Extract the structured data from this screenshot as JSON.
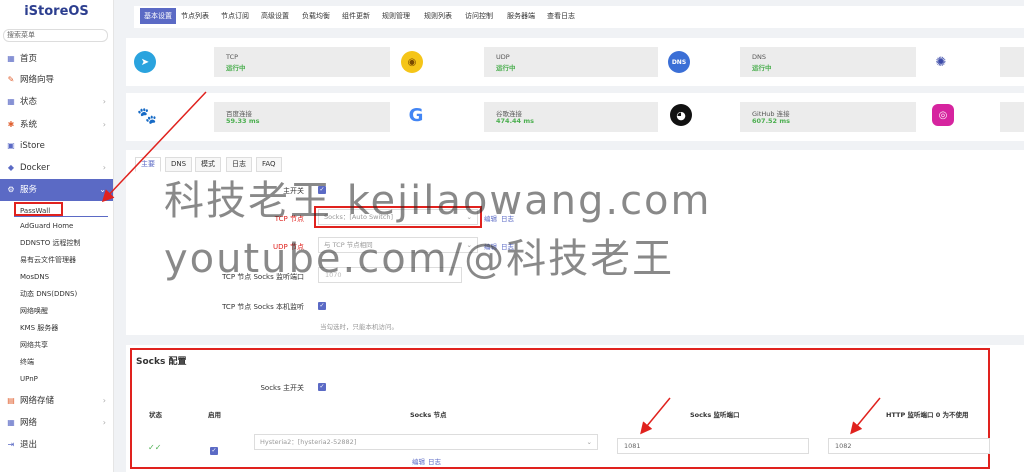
{
  "sidebar": {
    "logo": "iStoreOS",
    "search": "搜索菜单",
    "items": [
      {
        "label": "首页",
        "icon": "home-icon"
      },
      {
        "label": "网络向导",
        "icon": "wizard-icon"
      },
      {
        "label": "状态",
        "icon": "status-icon"
      },
      {
        "label": "系统",
        "icon": "gear-icon"
      },
      {
        "label": "iStore",
        "icon": "store-icon"
      },
      {
        "label": "Docker",
        "icon": "docker-icon"
      },
      {
        "label": "服务",
        "icon": "service-icon"
      },
      {
        "label": "网络存储",
        "icon": "storage-icon"
      },
      {
        "label": "网络",
        "icon": "network-icon"
      },
      {
        "label": "退出",
        "icon": "logout-icon"
      }
    ],
    "subitems": [
      "PassWall",
      "AdGuard Home",
      "DDNSTO 远程控制",
      "易有云文件管理器",
      "MosDNS",
      "动态 DNS(DDNS)",
      "网络唤醒",
      "KMS 服务器",
      "网络共享",
      "终端",
      "UPnP"
    ]
  },
  "topbar": {
    "tabs": [
      "基本设置",
      "节点列表",
      "节点订阅",
      "高级设置",
      "负载均衡",
      "组件更新",
      "规则管理",
      "规则列表",
      "访问控制",
      "服务器端",
      "查看日志"
    ]
  },
  "status_tiles": [
    {
      "title": "TCP",
      "status": "运行中",
      "icon": "telegram-icon"
    },
    {
      "title": "UDP",
      "status": "运行中",
      "icon": "gamepad-icon"
    },
    {
      "title": "DNS",
      "status": "运行中",
      "icon": "dns-icon"
    },
    {
      "title": "百度连接",
      "status": "59.33 ms",
      "icon": "baidu-icon"
    },
    {
      "title": "谷歌连接",
      "status": "474.44 ms",
      "icon": "google-icon"
    },
    {
      "title": "GitHub 连接",
      "status": "607.52 ms",
      "icon": "github-icon"
    }
  ],
  "main_tabs": [
    "主要",
    "DNS",
    "模式",
    "日志",
    "FAQ"
  ],
  "form": {
    "main_switch": "主开关",
    "tcp_node_label": "TCP 节点",
    "tcp_node_value": "Socks：[Auto Switch]",
    "udp_node_label": "UDP 节点",
    "udp_node_value": "与 TCP 节点相同",
    "edit": "编辑",
    "log": "日志",
    "socks_port_label": "TCP 节点 Socks 监听端口",
    "socks_port_value": "1070",
    "socks_local_label": "TCP 节点 Socks 本机监听",
    "socks_local_hint": "当勾选时，只能本机访问。"
  },
  "socks": {
    "title": "Socks 配置",
    "main_switch": "Socks 主开关",
    "headers": [
      "状态",
      "启用",
      "Socks 节点",
      "Socks 监听端口",
      "HTTP 监听端口 0 为不使用"
    ],
    "row": {
      "status": "✓✓",
      "node": "Hysteria2：[hysteria2-52882]",
      "socks_port": "1081",
      "http_port": "1082",
      "edit": "编辑",
      "log": "日志"
    }
  },
  "watermark": {
    "line1": "科技老王 kejilaowang.com",
    "line2": "youtube.com/@科技老王"
  },
  "colors": {
    "accent": "#5b6ac5",
    "highlight": "#e0221e",
    "running": "#4caf50"
  }
}
